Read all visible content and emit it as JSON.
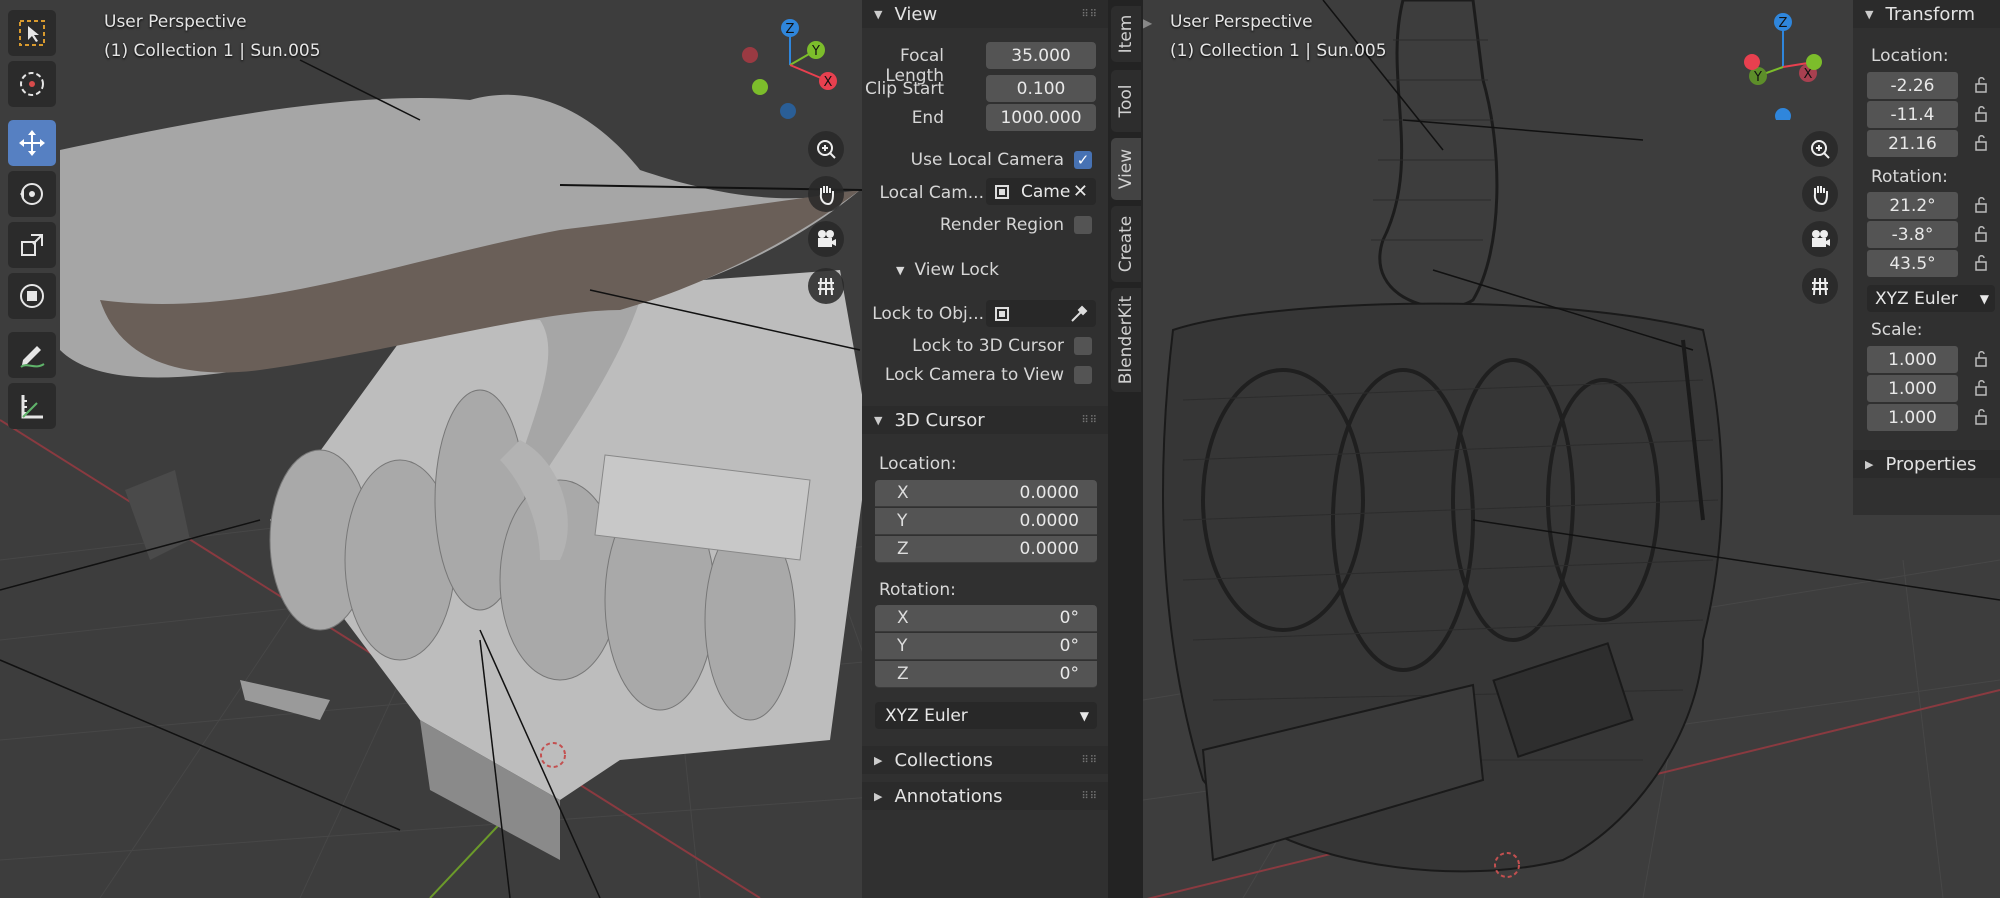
{
  "left_viewport": {
    "perspective_label": "User Perspective",
    "collection_label": "(1) Collection 1 | Sun.005",
    "toolbar": [
      "select-box-icon",
      "cursor-icon",
      "move-icon",
      "rotate-icon",
      "scale-icon",
      "transform-icon",
      "annotate-icon",
      "measure-icon"
    ]
  },
  "view_panel": {
    "title": "View",
    "focal_length_label": "Focal Length",
    "focal_length": "35.000",
    "clip_start_label": "Clip Start",
    "clip_start": "0.100",
    "clip_end_label": "End",
    "clip_end": "1000.000",
    "use_local_camera_label": "Use Local Camera",
    "local_camera_label": "Local Cam...",
    "local_camera_value": "Came",
    "render_region_label": "Render Region",
    "view_lock_title": "View Lock",
    "lock_to_object_label": "Lock to Obj...",
    "lock_to_cursor_label": "Lock to 3D Cursor",
    "lock_camera_label": "Lock Camera to View"
  },
  "cursor_panel": {
    "title": "3D Cursor",
    "location_label": "Location:",
    "location": [
      {
        "axis": "X",
        "value": "0.0000"
      },
      {
        "axis": "Y",
        "value": "0.0000"
      },
      {
        "axis": "Z",
        "value": "0.0000"
      }
    ],
    "rotation_label": "Rotation:",
    "rotation": [
      {
        "axis": "X",
        "value": "0°"
      },
      {
        "axis": "Y",
        "value": "0°"
      },
      {
        "axis": "Z",
        "value": "0°"
      }
    ],
    "rotation_mode": "XYZ Euler"
  },
  "collapsed_panels": {
    "collections": "Collections",
    "annotations": "Annotations"
  },
  "tabs": [
    "Item",
    "Tool",
    "View",
    "Create",
    "BlenderKit"
  ],
  "right_viewport": {
    "perspective_label": "User Perspective",
    "collection_label": "(1) Collection 1 | Sun.005"
  },
  "transform_panel": {
    "title": "Transform",
    "location_label": "Location:",
    "location": [
      "-2.26",
      "-11.4",
      "21.16"
    ],
    "rotation_label": "Rotation:",
    "rotation": [
      "21.2°",
      "-3.8°",
      "43.5°"
    ],
    "rotation_mode": "XYZ Euler",
    "scale_label": "Scale:",
    "scale": [
      "1.000",
      "1.000",
      "1.000"
    ],
    "properties": "Properties"
  },
  "gizmo_axes": {
    "x": "X",
    "y": "Y",
    "z": "Z"
  },
  "colors": {
    "x_axis": "#e8404f",
    "y_axis": "#7cbd2b",
    "z_axis": "#2f86dc",
    "accent": "#4772b3"
  }
}
